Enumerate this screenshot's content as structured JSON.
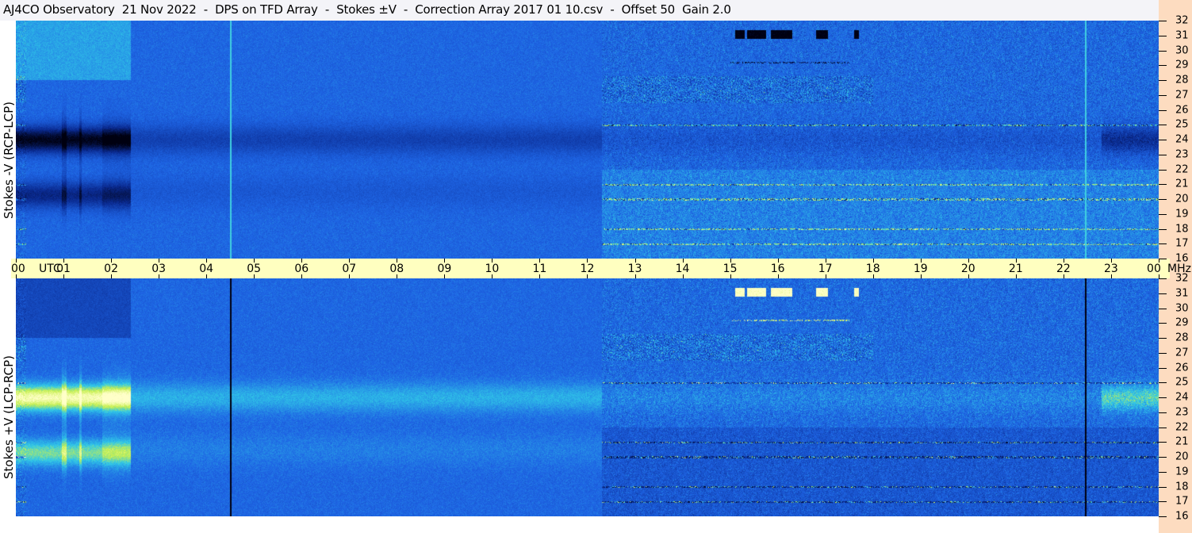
{
  "header": {
    "title": "AJ4CO Observatory  21 Nov 2022  -  DPS on TFD Array  -  Stokes ±V  -  Correction Array 2017 01 10.csv  -  Offset 50  Gain 2.0"
  },
  "chart_data": {
    "type": "heatmap",
    "title": "AJ4CO Observatory  21 Nov 2022  -  DPS on TFD Array  -  Stokes ±V  -  Correction Array 2017 01 10.csv  -  Offset 50  Gain 2.0",
    "x_axis": {
      "label": "UTC",
      "range_hours": [
        0,
        24
      ],
      "tick_labels": [
        "00",
        "01",
        "02",
        "03",
        "04",
        "05",
        "06",
        "07",
        "08",
        "09",
        "10",
        "11",
        "12",
        "13",
        "14",
        "15",
        "16",
        "17",
        "18",
        "19",
        "20",
        "21",
        "22",
        "23",
        "00"
      ]
    },
    "y_axis": {
      "unit": "MHz",
      "range": [
        16,
        32
      ],
      "tick_labels": [
        "32",
        "31",
        "30",
        "29",
        "28",
        "27",
        "26",
        "25",
        "24",
        "23",
        "22",
        "21",
        "20",
        "19",
        "18",
        "17",
        "16"
      ]
    },
    "panels": [
      {
        "name": "Stokes -V (RCP-LCP)",
        "sign": 1
      },
      {
        "name": "Stokes +V (LCP-RCP)",
        "sign": -1
      }
    ],
    "features": {
      "bursts_31mhz_hours": [
        [
          15.1,
          15.3
        ],
        [
          15.35,
          15.75
        ],
        [
          15.85,
          16.3
        ],
        [
          16.8,
          17.05
        ],
        [
          17.6,
          17.7
        ]
      ],
      "rfi_lines_mhz_after_12h": [
        25,
        21,
        20,
        18,
        17
      ],
      "vertical_lines_hours": [
        4.5,
        22.45
      ],
      "polarized_band_mhz": 24,
      "daytime_start_hour": 12.3
    },
    "colors": {
      "black": "#000010",
      "dark": "#0a2a90",
      "base": "#1e64e4",
      "cyan": "#30c8e8",
      "yellow": "#d8f040"
    }
  }
}
